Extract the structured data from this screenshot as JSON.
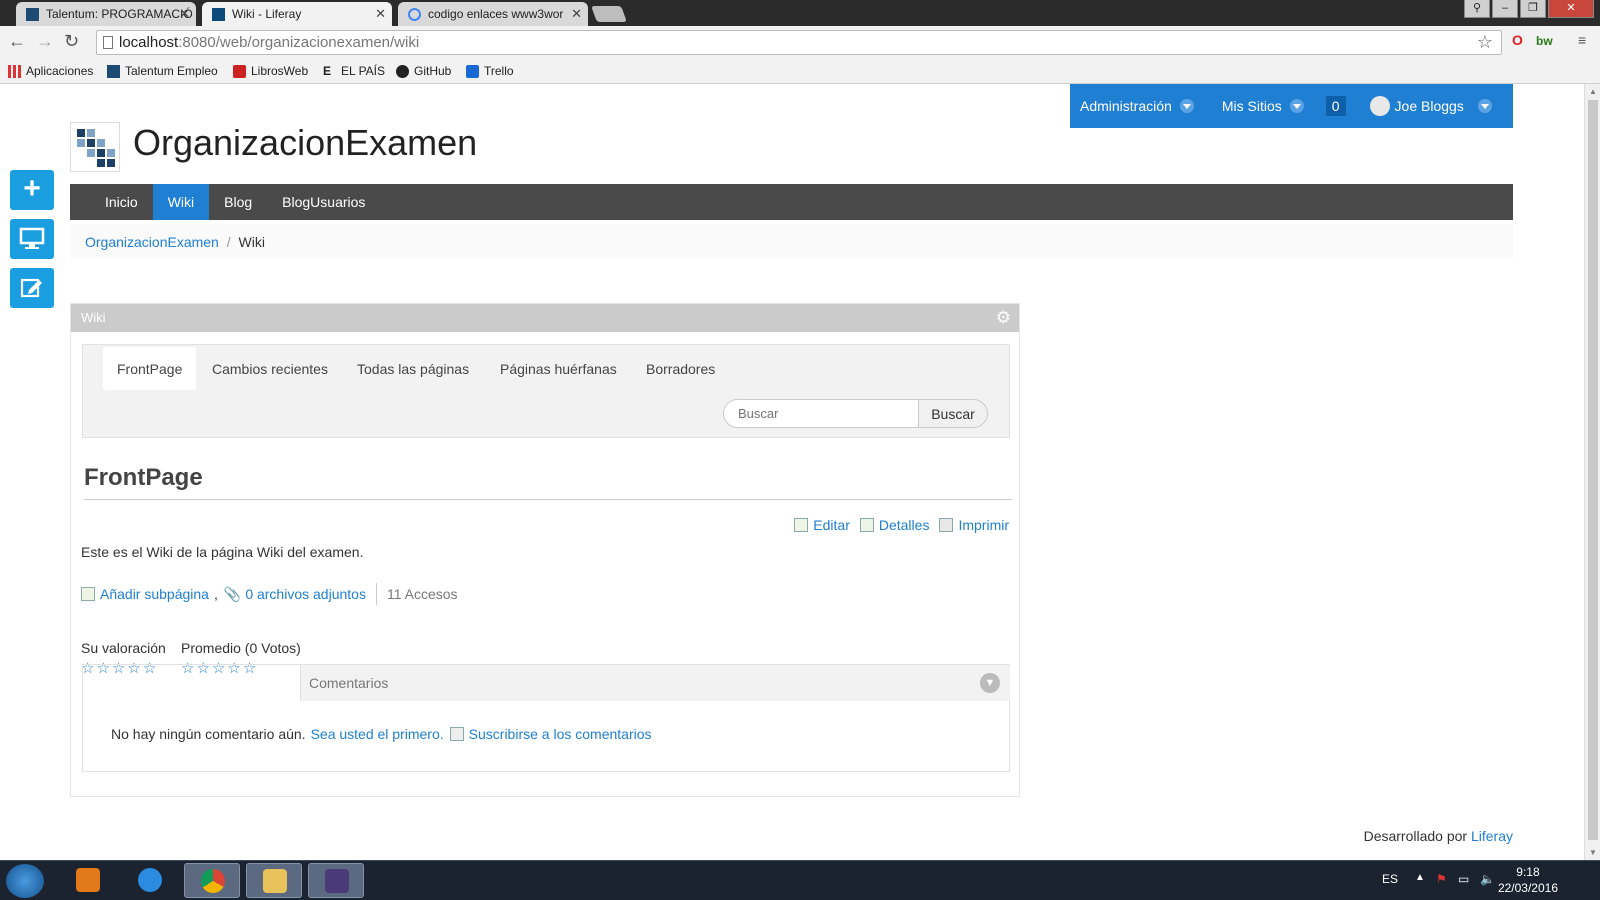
{
  "browser": {
    "tabs": [
      {
        "title": "Talentum: PROGRAMACIÓ",
        "active": false
      },
      {
        "title": "Wiki - Liferay",
        "active": true
      },
      {
        "title": "codigo enlaces www3wor",
        "active": false
      }
    ],
    "url_host": "localhost",
    "url_path": ":8080/web/organizacionexamen/wiki",
    "bookmarks": [
      "Aplicaciones",
      "Talentum Empleo",
      "LibrosWeb",
      "EL PAÍS",
      "GitHub",
      "Trello"
    ]
  },
  "dockbar": {
    "admin": "Administración",
    "sites": "Mis Sitios",
    "notifications": "0",
    "user": "Joe Bloggs"
  },
  "site": {
    "title": "OrganizacionExamen"
  },
  "nav": {
    "items": [
      {
        "label": "Inicio",
        "active": false
      },
      {
        "label": "Wiki",
        "active": true
      },
      {
        "label": "Blog",
        "active": false
      },
      {
        "label": "BlogUsuarios",
        "active": false
      }
    ]
  },
  "breadcrumb": {
    "root": "OrganizacionExamen",
    "separator": "/",
    "current": "Wiki"
  },
  "portlet": {
    "title": "Wiki",
    "tabs": [
      "FrontPage",
      "Cambios recientes",
      "Todas las páginas",
      "Páginas huérfanas",
      "Borradores"
    ],
    "search_placeholder": "Buscar",
    "search_button": "Buscar",
    "page_title": "FrontPage",
    "actions": [
      "Editar",
      "Detalles",
      "Imprimir"
    ],
    "content": "Este es el Wiki de la página Wiki del examen.",
    "add_subpage": "Añadir subpágina",
    "comma": ",",
    "attachments": "0 archivos adjuntos",
    "views": "11 Accesos",
    "your_rating": "Su valoración",
    "average": "Promedio (0 Votos)",
    "comments_title": "Comentarios",
    "no_comments": "No hay ningún comentario aún.",
    "be_first": "Sea usted el primero.",
    "subscribe": "Suscribirse a los comentarios"
  },
  "footer": {
    "powered_prefix": "Desarrollado por",
    "powered_link": "Liferay"
  },
  "taskbar": {
    "lang": "ES",
    "time": "9:18",
    "date": "22/03/2016"
  }
}
